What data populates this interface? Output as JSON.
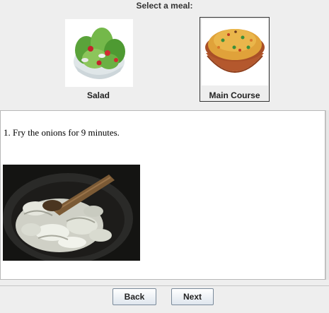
{
  "header": {
    "title": "Select a meal:"
  },
  "meals": [
    {
      "label": "Salad",
      "selected": false,
      "icon": "salad-bowl-image"
    },
    {
      "label": "Main Course",
      "selected": true,
      "icon": "biryani-bowl-image"
    }
  ],
  "step": {
    "text": "1. Fry the onions for 9 minutes.",
    "image": "frying-onions-photo"
  },
  "footer": {
    "back_label": "Back",
    "next_label": "Next"
  }
}
